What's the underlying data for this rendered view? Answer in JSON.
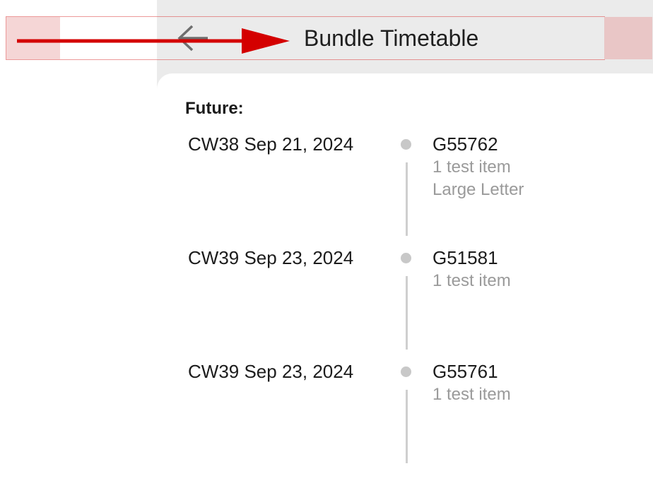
{
  "header": {
    "title": "Bundle Timetable",
    "back_icon": "arrow-left-icon"
  },
  "annotation": {
    "arrow_color": "#d40000",
    "highlight_color": "#f5d6d6"
  },
  "timetable": {
    "section_title": "Future:",
    "entries": [
      {
        "date": "CW38 Sep 21, 2024",
        "id": "G55762",
        "items": "1 test item",
        "type": "Large Letter"
      },
      {
        "date": "CW39 Sep 23, 2024",
        "id": "G51581",
        "items": "1 test item",
        "type": ""
      },
      {
        "date": "CW39 Sep 23, 2024",
        "id": "G55761",
        "items": "1 test item",
        "type": ""
      }
    ]
  }
}
